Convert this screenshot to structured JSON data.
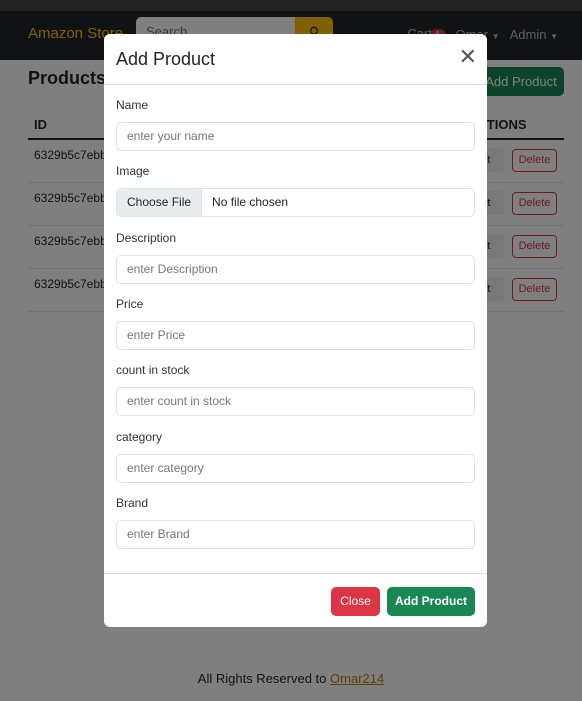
{
  "navbar": {
    "brand": "Amazon Store",
    "search_placeholder": "Search",
    "cart_label": "Cart",
    "cart_count": "1",
    "user_menu": "Omar",
    "admin_menu": "Admin"
  },
  "page": {
    "title": "Products",
    "add_button": "Add Product"
  },
  "table": {
    "headers": [
      "ID",
      "ACTIONS"
    ],
    "rows": [
      {
        "id": "6329b5c7ebb",
        "edit": "Edit",
        "delete": "Delete"
      },
      {
        "id": "6329b5c7ebb",
        "edit": "Edit",
        "delete": "Delete"
      },
      {
        "id": "6329b5c7ebb",
        "edit": "Edit",
        "delete": "Delete"
      },
      {
        "id": "6329b5c7ebb",
        "edit": "Edit",
        "delete": "Delete"
      }
    ]
  },
  "footer": {
    "text": "All Rights Reserved to ",
    "link": "Omar214"
  },
  "modal": {
    "title": "Add Product",
    "fields": [
      {
        "label": "Name",
        "placeholder": "enter your name"
      },
      {
        "label": "Image",
        "button": "Choose File",
        "value": "No file chosen"
      },
      {
        "label": "Description",
        "placeholder": "enter Description"
      },
      {
        "label": "Price",
        "placeholder": "enter Price"
      },
      {
        "label": "count in stock",
        "placeholder": "enter count in stock"
      },
      {
        "label": "category",
        "placeholder": "enter category"
      },
      {
        "label": "Brand",
        "placeholder": "enter Brand"
      }
    ],
    "close_button": "Close",
    "submit_button": "Add Product"
  },
  "colors": {
    "brand": "#ffc107",
    "success": "#198754",
    "danger": "#dc3545"
  }
}
